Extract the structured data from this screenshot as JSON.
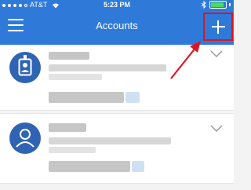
{
  "status_bar": {
    "carrier": "AT&T",
    "time": "5:23 PM"
  },
  "nav": {
    "title": "Accounts",
    "menu_icon": "hamburger-menu-icon",
    "add_icon": "plus-icon"
  },
  "accounts": [
    {
      "avatar_icon": "id-badge-icon",
      "expand_icon": "chevron-down-icon"
    },
    {
      "avatar_icon": "person-icon",
      "expand_icon": "chevron-down-icon"
    }
  ],
  "colors": {
    "header": "#2f7ad9",
    "avatar": "#2f64b4",
    "highlight": "#e0141e"
  }
}
